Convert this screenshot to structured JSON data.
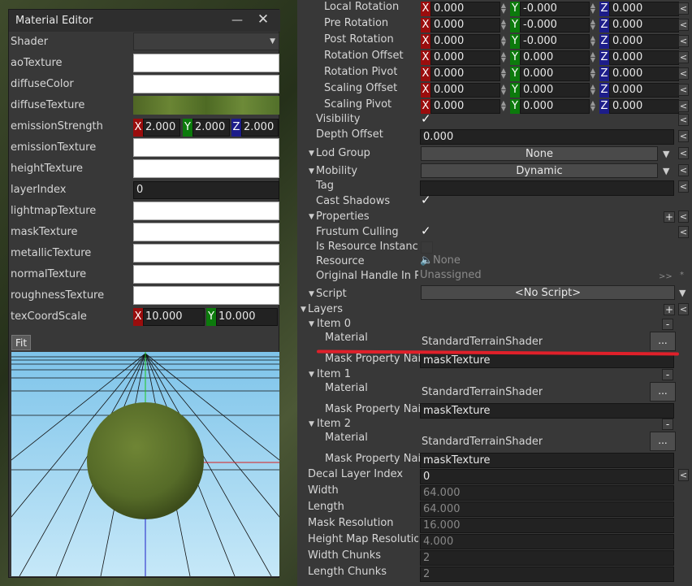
{
  "material_editor": {
    "title": "Material Editor",
    "minimize": "—",
    "close": "✕",
    "shader_label": "Shader",
    "shader_value": "",
    "rows": {
      "ao": "aoTexture",
      "diffuseColor": "diffuseColor",
      "diffuseTexture": "diffuseTexture",
      "emissionStrength": "emissionStrength",
      "emissionTexture": "emissionTexture",
      "heightTexture": "heightTexture",
      "layerIndex": "layerIndex",
      "lightmap": "lightmapTexture",
      "mask": "maskTexture",
      "metallic": "metallicTexture",
      "normal": "normalTexture",
      "roughness": "roughnessTexture",
      "texCoordScale": "texCoordScale"
    },
    "emission": {
      "x": "2.000",
      "y": "2.000",
      "z": "2.000"
    },
    "layer_index_value": "0",
    "texcoord": {
      "x": "10.000",
      "y": "10.000"
    },
    "axis": {
      "x": "X",
      "y": "Y",
      "z": "Z"
    },
    "fit": "Fit"
  },
  "inspector": {
    "vec_rows": [
      {
        "label": "Local Rotation",
        "x": "0.000",
        "y": "-0.000",
        "z": "0.000"
      },
      {
        "label": "Pre Rotation",
        "x": "0.000",
        "y": "-0.000",
        "z": "0.000"
      },
      {
        "label": "Post Rotation",
        "x": "0.000",
        "y": "-0.000",
        "z": "0.000"
      },
      {
        "label": "Rotation Offset",
        "x": "0.000",
        "y": "0.000",
        "z": "0.000"
      },
      {
        "label": "Rotation Pivot",
        "x": "0.000",
        "y": "0.000",
        "z": "0.000"
      },
      {
        "label": "Scaling Offset",
        "x": "0.000",
        "y": "0.000",
        "z": "0.000"
      },
      {
        "label": "Scaling Pivot",
        "x": "0.000",
        "y": "0.000",
        "z": "0.000"
      }
    ],
    "visibility": "Visibility",
    "depth_offset": "Depth Offset",
    "depth_offset_value": "0.000",
    "lod_group": "Lod Group",
    "lod_group_value": "None",
    "mobility": "Mobility",
    "mobility_value": "Dynamic",
    "tag": "Tag",
    "cast_shadows": "Cast Shadows",
    "properties": "Properties",
    "frustum_culling": "Frustum Culling",
    "is_resource_instance": "Is Resource Instanc",
    "resource": "Resource",
    "resource_value": "None",
    "original_handle": "Original Handle In R",
    "original_handle_value": "Unassigned",
    "script": "Script",
    "script_value": "<No Script>",
    "layers": "Layers",
    "items": [
      {
        "name": "Item 0",
        "material_label": "Material",
        "material_value": "StandardTerrainShader",
        "mask_label": "Mask Property Nai",
        "mask_value": "maskTexture"
      },
      {
        "name": "Item 1",
        "material_label": "Material",
        "material_value": "StandardTerrainShader",
        "mask_label": "Mask Property Nai",
        "mask_value": "maskTexture"
      },
      {
        "name": "Item 2",
        "material_label": "Material",
        "material_value": "StandardTerrainShader",
        "mask_label": "Mask Property Nai",
        "mask_value": "maskTexture"
      }
    ],
    "decal_layer_index": "Decal Layer Index",
    "decal_layer_index_value": "0",
    "width": "Width",
    "width_value": "64.000",
    "length": "Length",
    "length_value": "64.000",
    "mask_resolution": "Mask Resolution",
    "mask_resolution_value": "16.000",
    "height_map_resolution": "Height Map Resolutio",
    "height_map_resolution_value": "4.000",
    "width_chunks": "Width Chunks",
    "width_chunks_value": "2",
    "length_chunks": "Length Chunks",
    "length_chunks_value": "2",
    "browse": "...",
    "reset": "<",
    "plus": "+",
    "minus": "-",
    "check": "✓",
    "nav_arrows": ">>",
    "nav_star": "*"
  },
  "colors": {
    "annotation_line": "#e0202a",
    "sky": "#9fd4f0",
    "sphere": "#5a6e2c"
  }
}
